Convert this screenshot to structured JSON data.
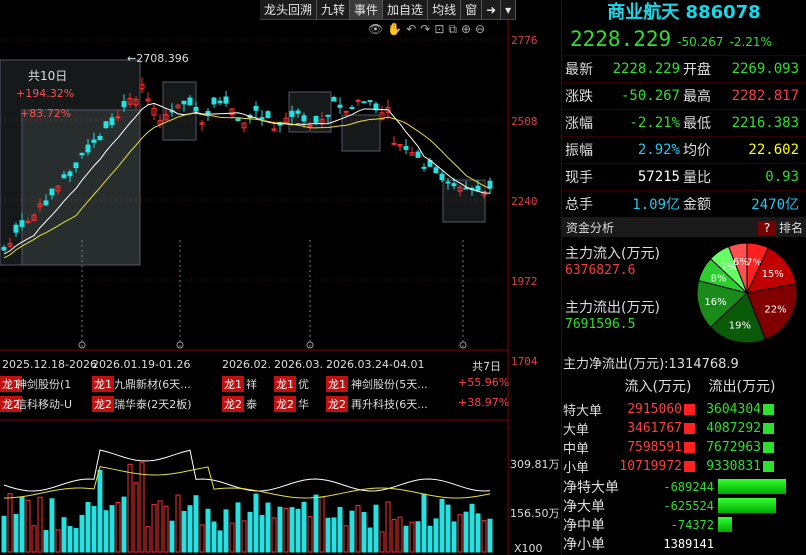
{
  "toolbar": {
    "items": [
      "龙头回溯",
      "九转",
      "事件",
      "加自选",
      "均线",
      "窗"
    ],
    "icons": [
      "arrow-right-icon",
      "chevron-down-icon"
    ]
  },
  "chart": {
    "axis_labels": [
      "2776",
      "2508",
      "2240",
      "1972",
      "1704"
    ],
    "high_marker": "2708.396",
    "zone_box": {
      "title": "共10日",
      "line1": "+194.32%",
      "line2": "+83.72%"
    },
    "vol_axis": [
      "309.81万",
      "156.50万",
      "X100"
    ],
    "period_bar": {
      "ranges": [
        "2025.12.18-2026",
        "2026.01.19-01.26",
        "2026.02.",
        "2026.03.",
        "2026.03.24-04.01"
      ],
      "total": "共7日"
    },
    "leaders": [
      {
        "tag": "龙1",
        "items": [
          "神剑股份(1",
          "九鼎新材(6天...",
          "祥",
          "优",
          "神剑股份(5天..."
        ],
        "pct": "+55.96%"
      },
      {
        "tag": "龙2",
        "items": [
          "信科移动-U",
          "瑞华泰(2天2板)",
          "泰",
          "华",
          "再升科技(6天..."
        ],
        "pct": "+38.97%"
      }
    ]
  },
  "panel": {
    "title": "商业航天 886078",
    "price": "2228.229",
    "change": "-50.267",
    "change_pct": "-2.21%",
    "rows": [
      {
        "l": "最新",
        "v": "2228.229",
        "vc": "green",
        "l2": "开盘",
        "v2": "2269.093",
        "v2c": "green"
      },
      {
        "l": "涨跌",
        "v": "-50.267",
        "vc": "green",
        "l2": "最高",
        "v2": "2282.817",
        "v2c": "red"
      },
      {
        "l": "涨幅",
        "v": "-2.21%",
        "vc": "green",
        "l2": "最低",
        "v2": "2216.383",
        "v2c": "green"
      },
      {
        "l": "振幅",
        "v": "2.92%",
        "vc": "cyan",
        "l2": "均价",
        "v2": "22.602",
        "v2c": "yellow"
      },
      {
        "l": "现手",
        "v": "57215",
        "vc": "white",
        "l2": "量比",
        "v2": "0.93",
        "v2c": "green"
      },
      {
        "l": "总手",
        "v": "1.09亿",
        "vc": "cyan",
        "l2": "金额",
        "v2": "2470亿",
        "v2c": "cyan"
      }
    ],
    "fund_title": "资金分析",
    "fund_q": "?",
    "fund_rank": "排名",
    "inflow_label": "主力流入(万元)",
    "inflow_value": "6376827.6",
    "outflow_label": "主力流出(万元)",
    "outflow_value": "7691596.5",
    "pie": [
      {
        "label": "7%",
        "color": "#ff2020"
      },
      {
        "label": "15%",
        "color": "#c00000"
      },
      {
        "label": "22%",
        "color": "#800000"
      },
      {
        "label": "19%",
        "color": "#0a5a0a"
      },
      {
        "label": "16%",
        "color": "#1a8a1a"
      },
      {
        "label": "8%",
        "color": "#2ecc2e"
      },
      {
        "label": "7%",
        "color": "#66ff66"
      },
      {
        "label": "6%",
        "color": "#ff5050"
      }
    ],
    "net_label": "主力净流出(万元):1314768.9",
    "table_head": [
      "流入(万元)",
      "流出(万元)"
    ],
    "table": [
      {
        "l": "特大单",
        "in": "2915060",
        "out": "3604304"
      },
      {
        "l": "大单",
        "in": "3461767",
        "out": "4087292"
      },
      {
        "l": "中单",
        "in": "7598591",
        "out": "7672963"
      },
      {
        "l": "小单",
        "in": "10719972",
        "out": "9330831"
      }
    ],
    "nets": [
      {
        "l": "净特大单",
        "v": "-689244",
        "vc": "green"
      },
      {
        "l": "净大单",
        "v": "-625524",
        "vc": "green"
      },
      {
        "l": "净中单",
        "v": "-74372",
        "vc": "green"
      },
      {
        "l": "净小单",
        "v": "1389141",
        "vc": "white"
      }
    ]
  }
}
